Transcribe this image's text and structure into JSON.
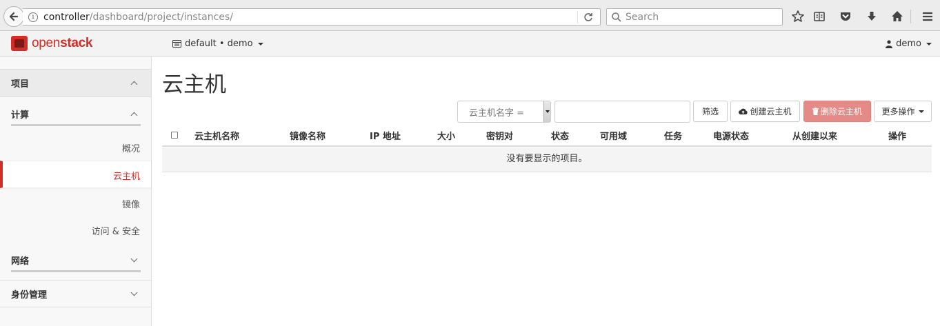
{
  "browser": {
    "url_host": "controller",
    "url_path": "/dashboard/project/instances/",
    "search_placeholder": "Search"
  },
  "header": {
    "logo_open": "open",
    "logo_stack": "stack",
    "project": "default • demo",
    "user": "demo"
  },
  "sidebar": {
    "project_label": "项目",
    "compute_label": "计算",
    "items": [
      "概况",
      "云主机",
      "镜像",
      "访问 & 安全"
    ],
    "active_item": "云主机",
    "network_label": "网络",
    "identity_label": "身份管理"
  },
  "main": {
    "title": "云主机",
    "filter_select": "云主机名字 =",
    "filter_button": "筛选",
    "create_button": "创建云主机",
    "delete_button": "删除云主机",
    "more_button": "更多操作"
  },
  "table": {
    "columns": [
      "云主机名称",
      "镜像名称",
      "IP 地址",
      "大小",
      "密钥对",
      "状态",
      "可用域",
      "任务",
      "电源状态",
      "从创建以来",
      "操作"
    ],
    "empty_message": "没有要显示的项目。"
  }
}
